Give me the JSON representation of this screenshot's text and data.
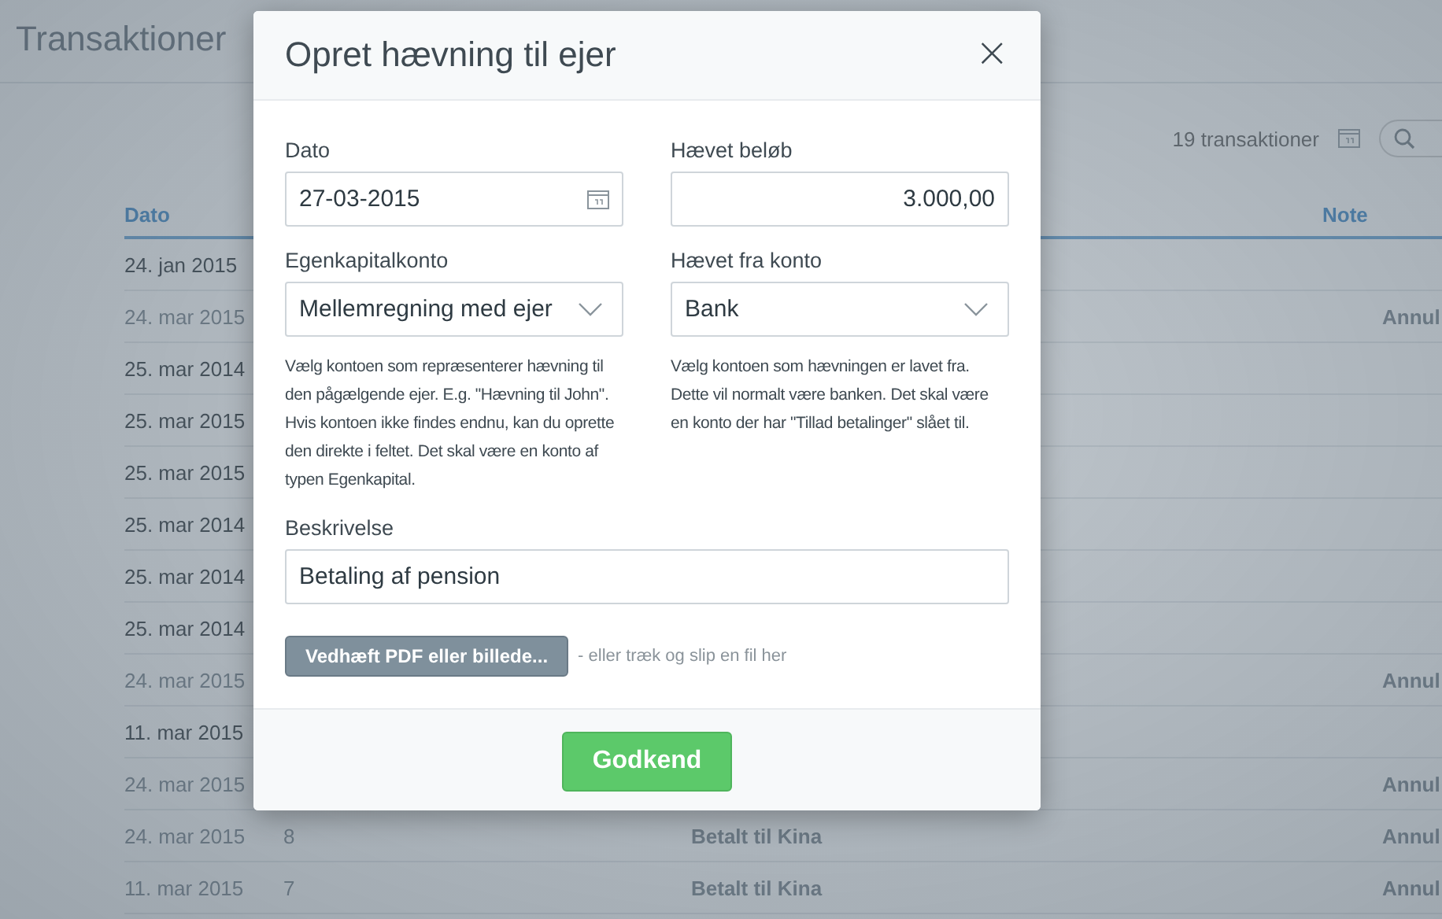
{
  "page": {
    "title": "Transaktioner",
    "count": "19 transaktioner"
  },
  "table": {
    "columns": [
      {
        "label": "Dato"
      },
      {
        "label": "Note"
      }
    ],
    "rows": [
      {
        "date": "24. jan 2015",
        "voided": false
      },
      {
        "date": "24. mar 2015",
        "voided": true,
        "note": "Annul"
      },
      {
        "date": "25. mar 2014",
        "voided": false
      },
      {
        "date": "25. mar 2015",
        "voided": false
      },
      {
        "date": "25. mar 2015",
        "voided": false
      },
      {
        "date": "25. mar 2014",
        "voided": false
      },
      {
        "date": "25. mar 2014",
        "voided": false
      },
      {
        "date": "25. mar 2014",
        "voided": false
      },
      {
        "date": "24. mar 2015",
        "voided": true,
        "note": "Annul"
      },
      {
        "date": "11. mar 2015",
        "voided": false
      },
      {
        "date": "24. mar 2015",
        "voided": true,
        "note": "Annul"
      },
      {
        "date": "24. mar 2015",
        "voided": true,
        "number": "8",
        "text": "Betalt til Kina",
        "note": "Annul"
      },
      {
        "date": "11. mar 2015",
        "voided": true,
        "number": "7",
        "text": "Betalt til Kina",
        "note": "Annul"
      }
    ]
  },
  "dialog": {
    "title": "Opret hævning til ejer",
    "close": "×",
    "fields": [
      {
        "kind": "date",
        "label": "Dato",
        "value": "27-03-2015"
      },
      {
        "kind": "amount",
        "label": "Hævet beløb",
        "value": "3.000,00"
      },
      {
        "kind": "select",
        "label": "Egenkapitalkonto",
        "value": "Mellemregning med ejer",
        "help": "Vælg kontoen som repræsenterer hævning til den pågælgende ejer. E.g. \"Hævning til John\". Hvis kontoen ikke findes endnu, kan du oprette den direkte i feltet. Det skal være en konto af typen Egenkapital."
      },
      {
        "kind": "select",
        "label": "Hævet fra konto",
        "value": "Bank",
        "help": "Vælg kontoen som hævningen er lavet fra. Dette vil normalt være banken. Det skal være en konto der har \"Tillad betalinger\" slået til."
      },
      {
        "kind": "text",
        "label": "Beskrivelse",
        "value": "Betaling af pension"
      }
    ],
    "attach": {
      "button": "Vedhæft PDF eller billede...",
      "hint": "- eller træk og slip en fil her"
    },
    "submit": "Godkend"
  }
}
